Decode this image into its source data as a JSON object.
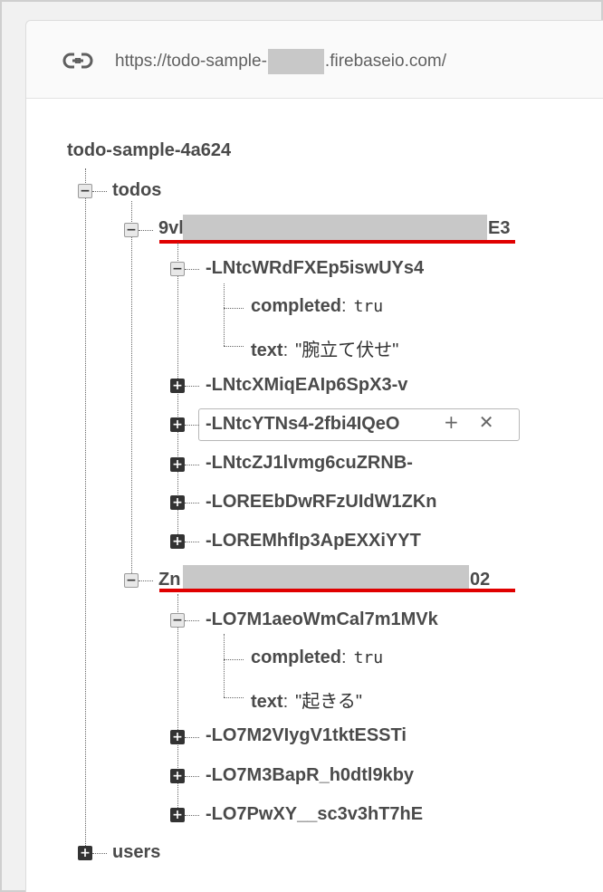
{
  "url": {
    "prefix": "https://todo-sample-",
    "suffix": ".firebaseio.com/",
    "icon": "link-icon"
  },
  "root": {
    "label": "todo-sample-4a624"
  },
  "todos": {
    "label": "todos",
    "user1": {
      "prefix": "9vl",
      "suffix": "E3",
      "items": [
        {
          "key": "-LNtcWRdFXEp5iswUYs4",
          "expanded": true,
          "completed_label": "completed",
          "completed_value": "tru",
          "text_label": "text",
          "text_value": "\"腕立て伏せ\""
        },
        {
          "key": "-LNtcXMiqEAIp6SpX3-v",
          "expanded": false
        },
        {
          "key": "-LNtcYTNs4-2fbi4IQeO",
          "expanded": false
        },
        {
          "key": "-LNtcZJ1lvmg6cuZRNB-",
          "expanded": false
        },
        {
          "key": "-LOREEbDwRFzUIdW1ZKn",
          "expanded": false
        },
        {
          "key": "-LOREMhfIp3ApEXXiYYT",
          "expanded": false
        }
      ]
    },
    "user2": {
      "prefix": "Zn",
      "suffix": "02",
      "items": [
        {
          "key": "-LO7M1aeoWmCal7m1MVk",
          "expanded": true,
          "completed_label": "completed",
          "completed_value": "tru",
          "text_label": "text",
          "text_value": "\"起きる\""
        },
        {
          "key": "-LO7M2VIygV1tktESSTi",
          "expanded": false
        },
        {
          "key": "-LO7M3BapR_h0dtl9kby",
          "expanded": false
        },
        {
          "key": "-LO7PwXY__sc3v3hT7hE",
          "expanded": false
        }
      ]
    }
  },
  "users": {
    "label": "users"
  },
  "hover_actions": {
    "add": "+",
    "remove": "✕"
  },
  "colors": {
    "highlight": "#e00000",
    "redacted": "#c8c8c8"
  }
}
